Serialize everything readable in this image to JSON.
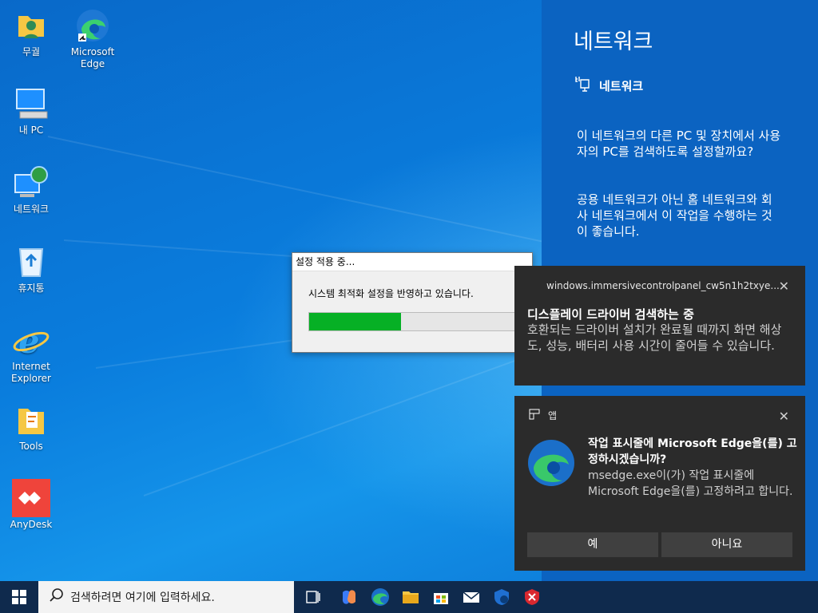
{
  "desktop": {
    "icons": [
      {
        "label": "무궐",
        "icon": "user-folder-icon"
      },
      {
        "label": "Microsoft Edge",
        "icon": "edge-icon"
      },
      {
        "label": "내 PC",
        "icon": "this-pc-icon"
      },
      {
        "label": "네트워크",
        "icon": "network-icon"
      },
      {
        "label": "휴지통",
        "icon": "recycle-bin-icon"
      },
      {
        "label": "Internet Explorer",
        "icon": "internet-explorer-icon"
      },
      {
        "label": "Tools",
        "icon": "tools-folder-icon"
      },
      {
        "label": "AnyDesk",
        "icon": "anydesk-icon"
      }
    ]
  },
  "network_panel": {
    "title": "네트워크",
    "subheading": "네트워크",
    "paragraph1": "이 네트워크의 다른 PC 및 장치에서 사용자의 PC를 검색하도록 설정할까요?",
    "paragraph2": "공용 네트워크가 아닌 홈 네트워크와 회사 네트워크에서 이 작업을 수행하는 것이 좋습니다."
  },
  "progress_dialog": {
    "title": "설정 적용 중...",
    "message": "시스템 최적화 설정을 반영하고 있습니다.",
    "progress": 0.44
  },
  "toast_driver": {
    "source": "windows.immersivecontrolpanel_cw5n1h2txye...",
    "heading": "디스플레이 드라이버 검색하는 중",
    "body": "호환되는 드라이버 설치가 완료될 때까지 화면 해상도, 성능, 배터리 사용 시간이 줄어들 수 있습니다."
  },
  "toast_edge": {
    "app": "앱",
    "heading": "작업 표시줄에 Microsoft Edge을(를) 고정하시겠습니까?",
    "body": "msedge.exe이(가) 작업 표시줄에 Microsoft Edge을(를) 고정하려고 합니다.",
    "yes": "예",
    "no": "아니요"
  },
  "taskbar": {
    "search_placeholder": "검색하려면 여기에 입력하세요.",
    "pinned": [
      "task-view-icon",
      "copilot-icon",
      "edge-icon",
      "file-explorer-icon",
      "store-icon",
      "mail-icon",
      "defender-icon",
      "security-shield-icon"
    ]
  },
  "colors": {
    "panel": "#0b63c1",
    "toast_bg": "#2b2b2b",
    "progress_fill": "#06b025",
    "taskbar": "#0f2a4d"
  }
}
